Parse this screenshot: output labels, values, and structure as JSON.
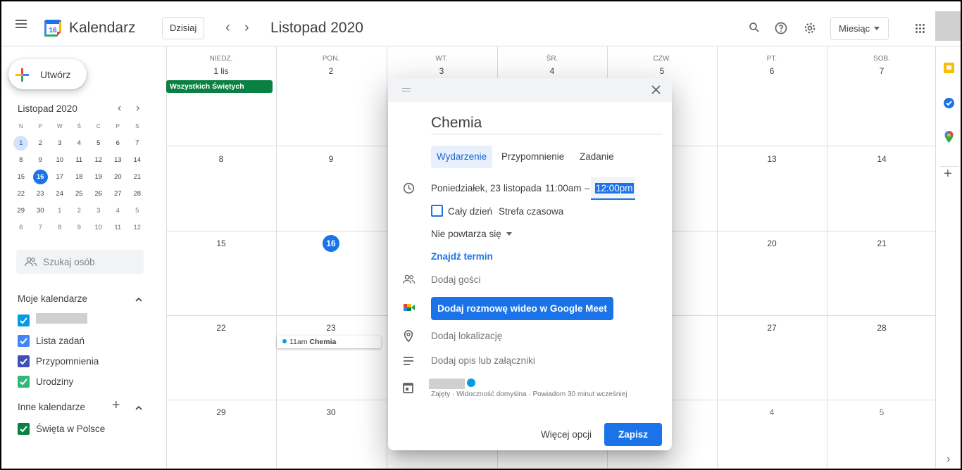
{
  "header": {
    "app_name": "Kalendarz",
    "logo_day": "16",
    "today_button": "Dzisiaj",
    "prev_arrow": "‹",
    "next_arrow": "›",
    "period_title": "Listopad 2020",
    "view_select": "Miesiąc",
    "icons": [
      "menu-icon",
      "search-icon",
      "help-icon",
      "settings-icon",
      "apps-grid-icon"
    ]
  },
  "sidebar": {
    "create_label": "Utwórz",
    "mini_month": {
      "title": "Listopad 2020",
      "weekdays": [
        "N",
        "P",
        "W",
        "Ś",
        "C",
        "P",
        "S"
      ],
      "weeks": [
        [
          "1",
          "2",
          "3",
          "4",
          "5",
          "6",
          "7"
        ],
        [
          "8",
          "9",
          "10",
          "11",
          "12",
          "13",
          "14"
        ],
        [
          "15",
          "16",
          "17",
          "18",
          "19",
          "20",
          "21"
        ],
        [
          "22",
          "23",
          "24",
          "25",
          "26",
          "27",
          "28"
        ],
        [
          "29",
          "30",
          "1",
          "2",
          "3",
          "4",
          "5"
        ],
        [
          "6",
          "7",
          "8",
          "9",
          "10",
          "11",
          "12"
        ]
      ]
    },
    "search_placeholder": "Szukaj osób",
    "my_calendars_title": "Moje kalendarze",
    "my_calendars": [
      {
        "label": "",
        "color": "#039be5"
      },
      {
        "label": "Lista zadań",
        "color": "#4285f4"
      },
      {
        "label": "Przypomnienia",
        "color": "#3f51b5"
      },
      {
        "label": "Urodziny",
        "color": "#33b679"
      }
    ],
    "other_calendars_title": "Inne kalendarze",
    "other_calendars": [
      {
        "label": "Święta w Polsce",
        "color": "#0b8043"
      }
    ]
  },
  "calendar": {
    "day_headers": [
      "NIEDZ.",
      "PON.",
      "WT.",
      "ŚR.",
      "CZW.",
      "PT.",
      "SOB."
    ],
    "week1": [
      "1 lis",
      "2",
      "3",
      "4",
      "5",
      "6",
      "7"
    ],
    "week2": [
      "8",
      "9",
      "13",
      "14"
    ],
    "week3": [
      "15",
      "16",
      "20",
      "21"
    ],
    "week4": [
      "22",
      "23",
      "27",
      "28"
    ],
    "week5": [
      "29",
      "30",
      "4",
      "5"
    ],
    "holiday_label": "Wszystkich Świętych",
    "holiday_color": "#0b8043",
    "event_time": "11am",
    "event_title": "Chemia"
  },
  "dialog": {
    "title_value": "Chemia",
    "tabs": [
      "Wydarzenie",
      "Przypomnienie",
      "Zadanie"
    ],
    "date_text": "Poniedziałek, 23 listopada",
    "start_time": "11:00am",
    "dash": "–",
    "end_time": "12:00pm",
    "all_day_label": "Cały dzień",
    "timezone_label": "Strefa czasowa",
    "repeat_label": "Nie powtarza się",
    "find_time_link": "Znajdź termin",
    "add_guests": "Dodaj gości",
    "meet_button": "Dodaj rozmowę wideo w Google Meet",
    "add_location": "Dodaj lokalizację",
    "add_description": "Dodaj opis lub załączniki",
    "calendar_meta": "Zajęty · Widoczność domyślna · Powiadom 30 minut wcześniej",
    "more_options": "Więcej opcji",
    "save_button": "Zapisz",
    "accent": "#1a73e8"
  },
  "rail": {
    "icons": [
      "keep-icon",
      "tasks-icon",
      "maps-icon",
      "add-icon",
      "expand-icon"
    ]
  }
}
